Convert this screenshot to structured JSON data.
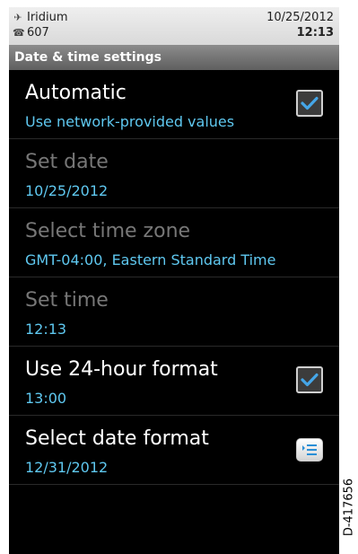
{
  "status": {
    "carrier": "Iridium",
    "line2": "607",
    "date": "10/25/2012",
    "time": "12:13"
  },
  "header": {
    "title": "Date & time settings"
  },
  "settings": [
    {
      "title": "Automatic",
      "subtitle": "Use network-provided values",
      "control": "checkbox",
      "checked": true,
      "enabled": true
    },
    {
      "title": "Set date",
      "subtitle": "10/25/2012",
      "enabled": false
    },
    {
      "title": "Select time zone",
      "subtitle": "GMT-04:00, Eastern Standard Time",
      "enabled": false
    },
    {
      "title": "Set time",
      "subtitle": "12:13",
      "enabled": false
    },
    {
      "title": "Use 24-hour format",
      "subtitle": "13:00",
      "control": "checkbox",
      "checked": true,
      "enabled": true
    },
    {
      "title": "Select date format",
      "subtitle": "12/31/2012",
      "control": "menu",
      "enabled": true
    }
  ],
  "caption": "D-417656",
  "colors": {
    "accent": "#5fc8f0",
    "check": "#45a6e8",
    "disabled": "#777777"
  },
  "icons": {
    "carrier": "satellite-icon",
    "line": "handset-icon"
  }
}
